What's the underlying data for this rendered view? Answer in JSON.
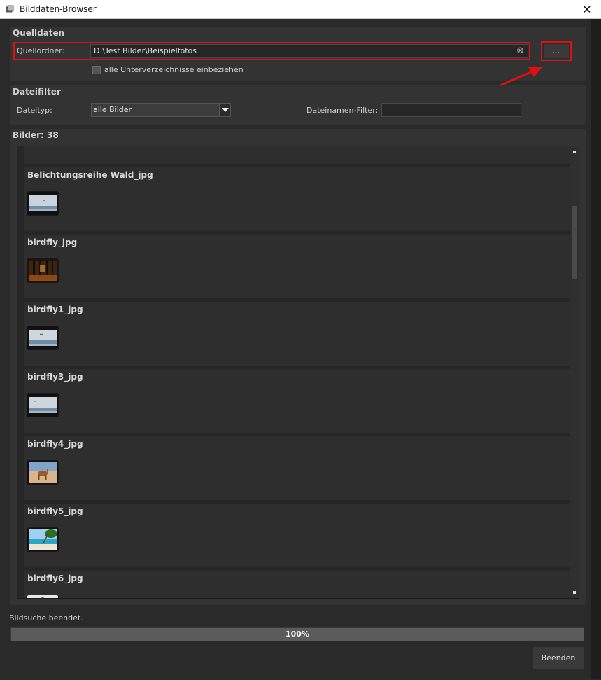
{
  "window": {
    "title": "Bilddaten-Browser",
    "close_glyph": "✕"
  },
  "source": {
    "section_title": "Quelldaten",
    "folder_label": "Quellordner:",
    "folder_value": "D:\\Test Bilder\\Beispielfotos",
    "clear_glyph": "⊗",
    "browse_label": "...",
    "subdirs_label": "alle Unterverzeichnisse einbeziehen",
    "subdirs_checked": false
  },
  "filter": {
    "section_title": "Dateifilter",
    "type_label": "Dateityp:",
    "type_value": "alle Bilder",
    "name_filter_label": "Dateinamen-Filter:",
    "name_filter_value": ""
  },
  "images": {
    "count_label": "Bilder: 38",
    "items": [
      {
        "name": "Belichtungsreihe Wald_jpg",
        "thumb": "sky-sea"
      },
      {
        "name": "birdfly_jpg",
        "thumb": "forest"
      },
      {
        "name": "birdfly1_jpg",
        "thumb": "sky-sea"
      },
      {
        "name": "birdfly3_jpg",
        "thumb": "sky-sea"
      },
      {
        "name": "birdfly4_jpg",
        "thumb": "camel"
      },
      {
        "name": "birdfly5_jpg",
        "thumb": "beach"
      },
      {
        "name": "birdfly6_jpg",
        "thumb": "dark"
      }
    ]
  },
  "status": {
    "text": "Bildsuche beendet.",
    "progress_percent": 100,
    "progress_label": "100%"
  },
  "footer": {
    "close_button": "Beenden"
  },
  "colors": {
    "highlight_red": "#e01010",
    "background": "#2a2a2a",
    "panel": "#333333"
  }
}
